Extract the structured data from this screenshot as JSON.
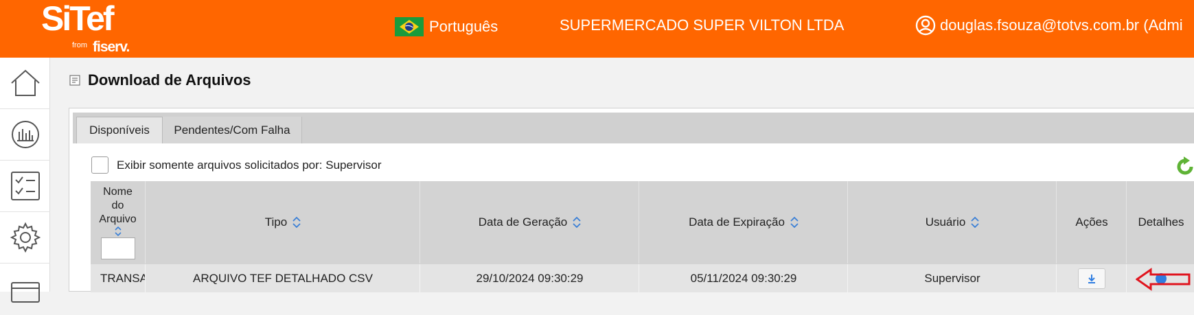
{
  "header": {
    "logo_main": "SiTef",
    "logo_from": "from",
    "logo_fiserv": "fiserv.",
    "language": "Português",
    "company": "SUPERMERCADO SUPER VILTON LTDA",
    "user": "douglas.fsouza@totvs.com.br (Admi",
    "brand_color": "#ff6600"
  },
  "sidebar": {
    "items": [
      {
        "icon": "home-icon"
      },
      {
        "icon": "chart-icon"
      },
      {
        "icon": "checklist-icon"
      },
      {
        "icon": "gear-icon"
      },
      {
        "icon": "card-icon"
      }
    ]
  },
  "page": {
    "title": "Download de Arquivos"
  },
  "tabs": [
    {
      "label": "Disponíveis",
      "active": true
    },
    {
      "label": "Pendentes/Com Falha",
      "active": false
    }
  ],
  "filter": {
    "label": "Exibir somente arquivos solicitados por: Supervisor",
    "checked": false
  },
  "table": {
    "columns": {
      "name_line1": "Nome",
      "name_line2": "do",
      "name_line3": "Arquivo",
      "tipo": "Tipo",
      "geracao": "Data de Geração",
      "expiracao": "Data de Expiração",
      "usuario": "Usuário",
      "acoes": "Ações",
      "detalhes": "Detalhes"
    },
    "rows": [
      {
        "name": "TRANSA",
        "tipo": "ARQUIVO TEF DETALHADO CSV",
        "geracao": "29/10/2024 09:30:29",
        "expiracao": "05/11/2024 09:30:29",
        "usuario": "Supervisor"
      }
    ]
  }
}
